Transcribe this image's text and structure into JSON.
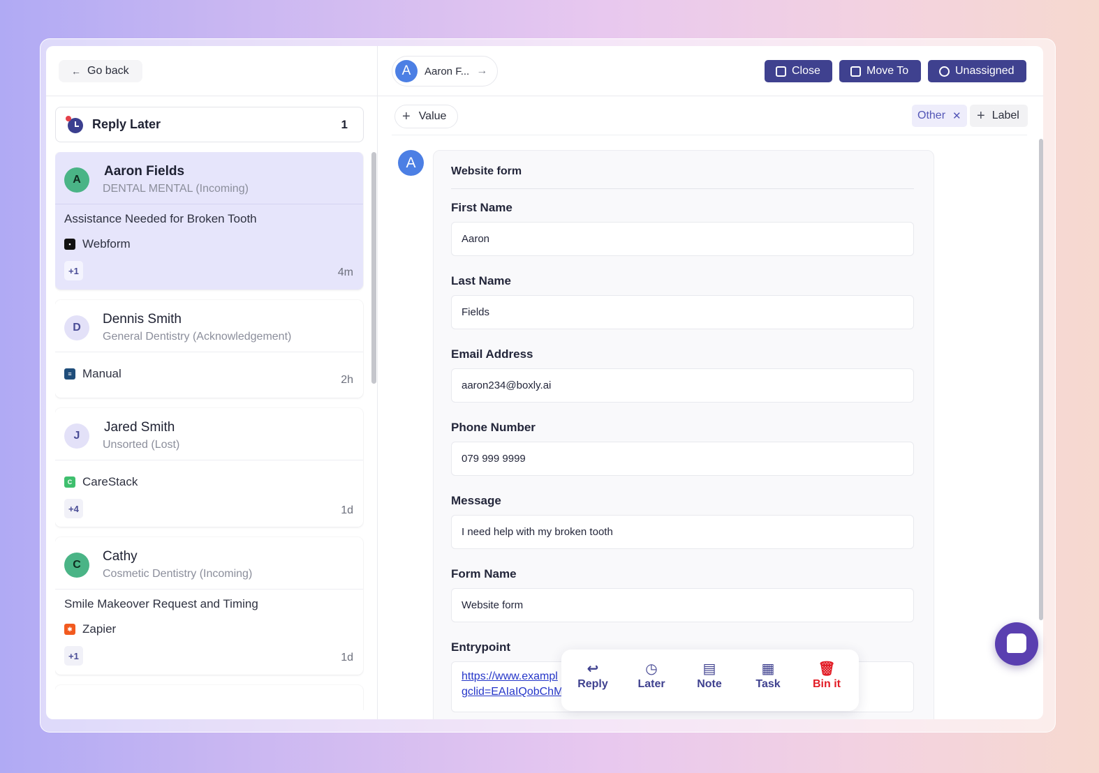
{
  "nav": {
    "go_back": "Go back"
  },
  "queue": {
    "label": "Reply Later",
    "count": "1"
  },
  "conversations": [
    {
      "initial": "A",
      "name": "Aaron Fields",
      "sub": "DENTAL MENTAL (Incoming)",
      "subject": "Assistance Needed for Broken Tooth",
      "source": "Webform",
      "extra": "+1",
      "time": "4m"
    },
    {
      "initial": "D",
      "name": "Dennis Smith",
      "sub": "General Dentistry (Acknowledgement)",
      "subject": "",
      "source": "Manual",
      "extra": "",
      "time": "2h"
    },
    {
      "initial": "J",
      "name": "Jared Smith",
      "sub": "Unsorted (Lost)",
      "subject": "",
      "source": "CareStack",
      "extra": "+4",
      "time": "1d"
    },
    {
      "initial": "C",
      "name": "Cathy",
      "sub": "Cosmetic Dentistry (Incoming)",
      "subject": "Smile Makeover Request and Timing",
      "source": "Zapier",
      "extra": "+1",
      "time": "1d"
    }
  ],
  "header": {
    "contact_initial": "A",
    "contact_name": "Aaron F...",
    "close_label": "Close",
    "move_label": "Move To",
    "assign_label": "Unassigned"
  },
  "filters": {
    "value_label": "Value",
    "tag": "Other",
    "label_button": "Label"
  },
  "form": {
    "avatar": "A",
    "title": "Website form",
    "fields": [
      {
        "label": "First Name",
        "value": "Aaron"
      },
      {
        "label": "Last Name",
        "value": "Fields"
      },
      {
        "label": "Email Address",
        "value": "aaron234@boxly.ai"
      },
      {
        "label": "Phone Number",
        "value": "079 999 9999"
      },
      {
        "label": "Message",
        "value": "I need help with my broken tooth"
      },
      {
        "label": "Form Name",
        "value": "Website form"
      },
      {
        "label": "Entrypoint",
        "value_line1": "https://www.exampl",
        "value_line2": "gclid=EAIaIQobChM"
      }
    ]
  },
  "actions": {
    "reply": "Reply",
    "later": "Later",
    "note": "Note",
    "task": "Task",
    "bin": "Bin it"
  },
  "colors": {
    "primary": "#3f418f",
    "danger": "#e21d26",
    "active_card": "#e6e5fb"
  }
}
